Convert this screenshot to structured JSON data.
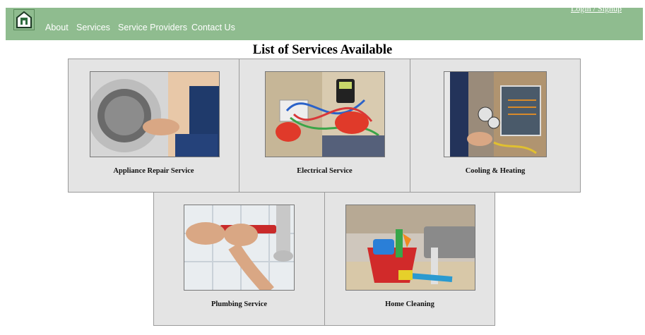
{
  "nav": {
    "links": [
      "About",
      "Services",
      "Service Providers",
      "Contact Us"
    ],
    "login": "Login / Signup",
    "logo_icon": "house-logo-icon",
    "background": "#8fbc8f"
  },
  "page": {
    "title": "List of Services Available"
  },
  "services": [
    {
      "label": "Appliance Repair Service",
      "image_icon": "washing-machine-repair-image"
    },
    {
      "label": "Electrical Service",
      "image_icon": "electrician-wiring-image"
    },
    {
      "label": "Cooling & Heating",
      "image_icon": "hvac-technician-image"
    },
    {
      "label": "Plumbing Service",
      "image_icon": "plumber-wrench-pipe-image"
    },
    {
      "label": "Home Cleaning",
      "image_icon": "cleaning-supplies-bucket-image"
    }
  ]
}
